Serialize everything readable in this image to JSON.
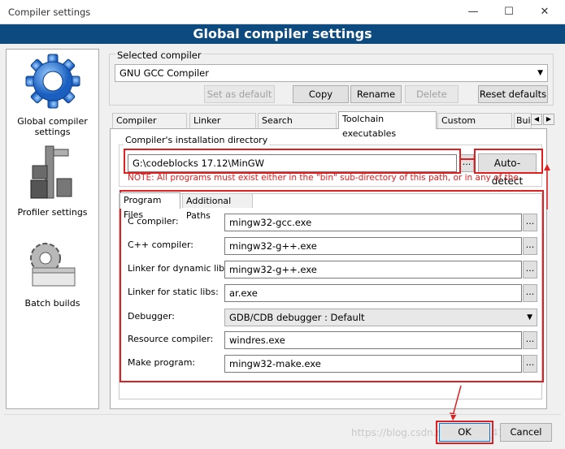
{
  "window": {
    "title": "Compiler settings",
    "minimize": "—",
    "maximize": "☐",
    "close": "✕"
  },
  "banner": "Global compiler settings",
  "sidebar": {
    "items": [
      {
        "label": "Global compiler settings",
        "icon": "gear-icon"
      },
      {
        "label": "Profiler settings",
        "icon": "caliper-icon"
      },
      {
        "label": "Batch builds",
        "icon": "gears-stack-icon"
      }
    ]
  },
  "selected_compiler": {
    "group_label": "Selected compiler",
    "value": "GNU GCC Compiler",
    "buttons": {
      "set_default": "Set as default",
      "copy": "Copy",
      "rename": "Rename",
      "delete": "Delete",
      "reset": "Reset defaults"
    }
  },
  "tabs": [
    "Compiler settings",
    "Linker settings",
    "Search directories",
    "Toolchain executables",
    "Custom variables",
    "Bui"
  ],
  "install_dir": {
    "label": "Compiler's installation directory",
    "value": "G:\\codeblocks 17.12\\MinGW",
    "browse": "...",
    "autodetect": "Auto-detect",
    "note": "NOTE: All programs must exist either in the \"bin\" sub-directory of this path, or in any of the"
  },
  "subtabs": [
    "Program Files",
    "Additional Paths"
  ],
  "programs": [
    {
      "label": "C compiler:",
      "value": "mingw32-gcc.exe"
    },
    {
      "label": "C++ compiler:",
      "value": "mingw32-g++.exe"
    },
    {
      "label": "Linker for dynamic libs:",
      "value": "mingw32-g++.exe"
    },
    {
      "label": "Linker for static libs:",
      "value": "ar.exe"
    },
    {
      "label": "Debugger:",
      "value": "GDB/CDB debugger : Default"
    },
    {
      "label": "Resource compiler:",
      "value": "windres.exe"
    },
    {
      "label": "Make program:",
      "value": "mingw32-make.exe"
    }
  ],
  "footer": {
    "ok": "OK",
    "cancel": "Cancel",
    "watermark": "https://blog.csdn.net/weixin_41810690"
  },
  "colors": {
    "banner": "#0c4a80",
    "highlight": "#e02020"
  }
}
